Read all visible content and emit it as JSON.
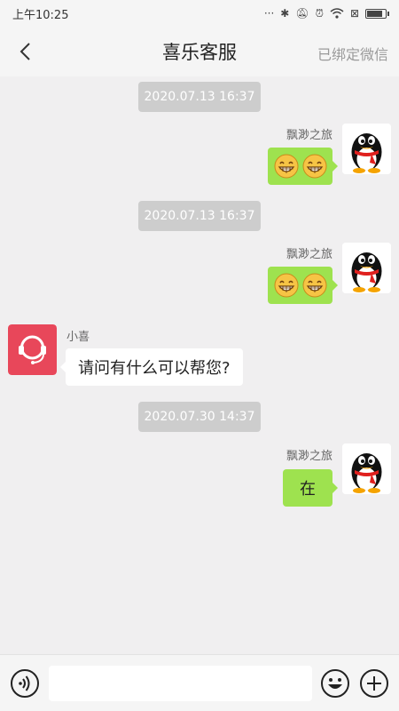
{
  "status_bar": {
    "time": "上午10:25",
    "icons": [
      "signal-dots-icon",
      "bluetooth-icon",
      "mute-icon",
      "alarm-icon",
      "wifi-icon",
      "sim-icon",
      "battery-icon"
    ],
    "battery_level": 0.9
  },
  "header": {
    "title": "喜乐客服",
    "right_action": "已绑定微信"
  },
  "messages": [
    {
      "type": "timestamp",
      "text": "2020.07.13 16:37"
    },
    {
      "type": "outgoing",
      "sender": "飘渺之旅",
      "content_type": "emoji",
      "emoji": [
        "grin-emoji",
        "grin-emoji"
      ]
    },
    {
      "type": "timestamp",
      "text": "2020.07.13 16:37"
    },
    {
      "type": "outgoing",
      "sender": "飘渺之旅",
      "content_type": "emoji",
      "emoji": [
        "grin-emoji",
        "grin-emoji"
      ]
    },
    {
      "type": "incoming",
      "sender": "小喜",
      "content_type": "text",
      "text": "请问有什么可以帮您?"
    },
    {
      "type": "timestamp",
      "text": "2020.07.30 14:37"
    },
    {
      "type": "outgoing",
      "sender": "飘渺之旅",
      "content_type": "text",
      "text": "在"
    }
  ],
  "input_bar": {
    "value": "",
    "placeholder": "",
    "buttons": [
      "voice-icon",
      "emoji-icon",
      "plus-icon"
    ]
  },
  "colors": {
    "outgoing_bubble": "#9ee24f",
    "incoming_bubble": "#ffffff",
    "timestamp_bg": "#cdcdcd",
    "service_avatar": "#e8475a",
    "page_bg": "#f0eff0"
  }
}
